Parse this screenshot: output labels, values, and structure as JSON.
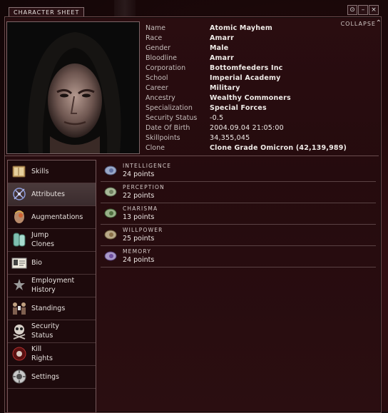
{
  "window": {
    "title": "CHARACTER SHEET",
    "controls": [
      "⊙",
      "–",
      "×"
    ],
    "collapse_label": "COLLAPSE"
  },
  "character_info": [
    {
      "label": "Name",
      "value": "Atomic Mayhem"
    },
    {
      "label": "Race",
      "value": "Amarr"
    },
    {
      "label": "Gender",
      "value": "Male"
    },
    {
      "label": "Bloodline",
      "value": "Amarr"
    },
    {
      "label": "Corporation",
      "value": "Bottomfeeders Inc"
    },
    {
      "label": "School",
      "value": "Imperial Academy"
    },
    {
      "label": "Career",
      "value": "Military"
    },
    {
      "label": "Ancestry",
      "value": "Wealthy Commoners"
    },
    {
      "label": "Specialization",
      "value": "Special Forces"
    },
    {
      "label": "Security Status",
      "value": "-0.5"
    },
    {
      "label": "Date Of Birth",
      "value": "2004.09.04 21:05:00"
    },
    {
      "label": "Skillpoints",
      "value": "34,355,045"
    },
    {
      "label": "Clone",
      "value": "Clone Grade Omicron (42,139,989)"
    }
  ],
  "nav": [
    {
      "line1": "Skills",
      "line2": "",
      "icon": "skills-book-icon",
      "active": false
    },
    {
      "line1": "Attributes",
      "line2": "",
      "icon": "attributes-icon",
      "active": true
    },
    {
      "line1": "Augmentations",
      "line2": "",
      "icon": "augmentations-icon",
      "active": false
    },
    {
      "line1": "Jump",
      "line2": "Clones",
      "icon": "jump-clones-icon",
      "active": false
    },
    {
      "line1": "Bio",
      "line2": "",
      "icon": "bio-icon",
      "active": false
    },
    {
      "line1": "Employment",
      "line2": "History",
      "icon": "employment-history-icon",
      "active": false
    },
    {
      "line1": "Standings",
      "line2": "",
      "icon": "standings-icon",
      "active": false
    },
    {
      "line1": "Security",
      "line2": "Status",
      "icon": "security-status-icon",
      "active": false
    },
    {
      "line1": "Kill",
      "line2": "Rights",
      "icon": "kill-rights-icon",
      "active": false
    },
    {
      "line1": "Settings",
      "line2": "",
      "icon": "settings-icon",
      "active": false
    }
  ],
  "attributes": [
    {
      "name": "INTELLIGENCE",
      "value": "24 points",
      "icon": "intelligence-implant-icon"
    },
    {
      "name": "PERCEPTION",
      "value": "22 points",
      "icon": "perception-implant-icon"
    },
    {
      "name": "CHARISMA",
      "value": "13 points",
      "icon": "charisma-implant-icon"
    },
    {
      "name": "WILLPOWER",
      "value": "25 points",
      "icon": "willpower-implant-icon"
    },
    {
      "name": "MEMORY",
      "value": "24 points",
      "icon": "memory-implant-icon"
    }
  ]
}
